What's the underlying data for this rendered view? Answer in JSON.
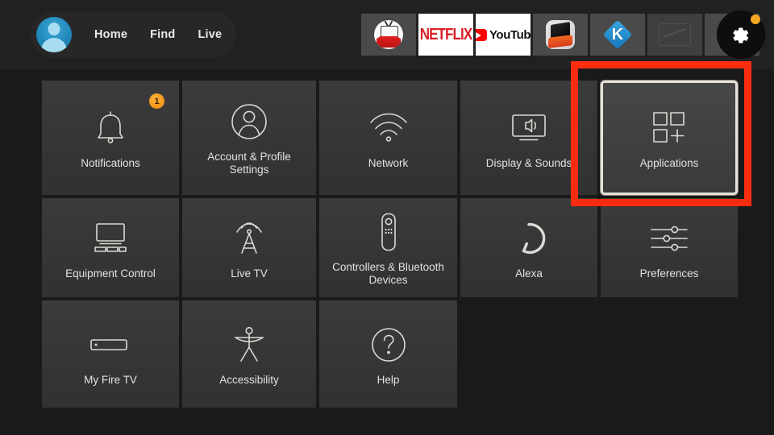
{
  "nav": {
    "avatar_name": "profile-avatar",
    "links": [
      {
        "label": "Home"
      },
      {
        "label": "Find"
      },
      {
        "label": "Live"
      }
    ],
    "apps": [
      {
        "name": "redbox-tv-app",
        "label": ""
      },
      {
        "name": "netflix-app",
        "label": "NETFLIX"
      },
      {
        "name": "youtube-app",
        "label": "YouTube"
      },
      {
        "name": "fire-app",
        "label": ""
      },
      {
        "name": "kodi-app",
        "label": "K"
      },
      {
        "name": "dim-app",
        "label": ""
      },
      {
        "name": "apps-grid",
        "label": ""
      }
    ],
    "settings_label": "Settings",
    "settings_badge": true
  },
  "grid": {
    "rows": [
      [
        {
          "id": "notifications",
          "label": "Notifications",
          "icon": "bell-icon",
          "badge": "1",
          "focused": false
        },
        {
          "id": "account-profile-settings",
          "label": "Account & Profile Settings",
          "icon": "person-circle-icon",
          "badge": null,
          "focused": false
        },
        {
          "id": "network",
          "label": "Network",
          "icon": "wifi-icon",
          "badge": null,
          "focused": false
        },
        {
          "id": "display-sounds",
          "label": "Display & Sounds",
          "icon": "tv-speaker-icon",
          "badge": null,
          "focused": false
        },
        {
          "id": "applications",
          "label": "Applications",
          "icon": "apps-grid-plus-icon",
          "badge": null,
          "focused": true
        }
      ],
      [
        {
          "id": "equipment-control",
          "label": "Equipment Control",
          "icon": "tv-equipment-icon",
          "badge": null,
          "focused": false
        },
        {
          "id": "live-tv",
          "label": "Live TV",
          "icon": "antenna-tower-icon",
          "badge": null,
          "focused": false
        },
        {
          "id": "controllers-bluetooth-devices",
          "label": "Controllers & Bluetooth Devices",
          "icon": "remote-control-icon",
          "badge": null,
          "focused": false
        },
        {
          "id": "alexa",
          "label": "Alexa",
          "icon": "alexa-ring-icon",
          "badge": null,
          "focused": false
        },
        {
          "id": "preferences",
          "label": "Preferences",
          "icon": "sliders-icon",
          "badge": null,
          "focused": false
        }
      ],
      [
        {
          "id": "my-fire-tv",
          "label": "My Fire TV",
          "icon": "firestick-icon",
          "badge": null,
          "focused": false
        },
        {
          "id": "accessibility",
          "label": "Accessibility",
          "icon": "accessibility-person-icon",
          "badge": null,
          "focused": false
        },
        {
          "id": "help",
          "label": "Help",
          "icon": "question-circle-icon",
          "badge": null,
          "focused": false
        }
      ]
    ]
  },
  "annotation": {
    "name": "applications-highlight-box",
    "color": "#ff2d10"
  },
  "colors": {
    "background": "#1a1a1a",
    "nav_background": "#212121",
    "tile": "#3a3a3a",
    "tile_focus_border": "#e6e2d8",
    "badge_orange": "#f5a623",
    "text": "#e2e2e2"
  }
}
